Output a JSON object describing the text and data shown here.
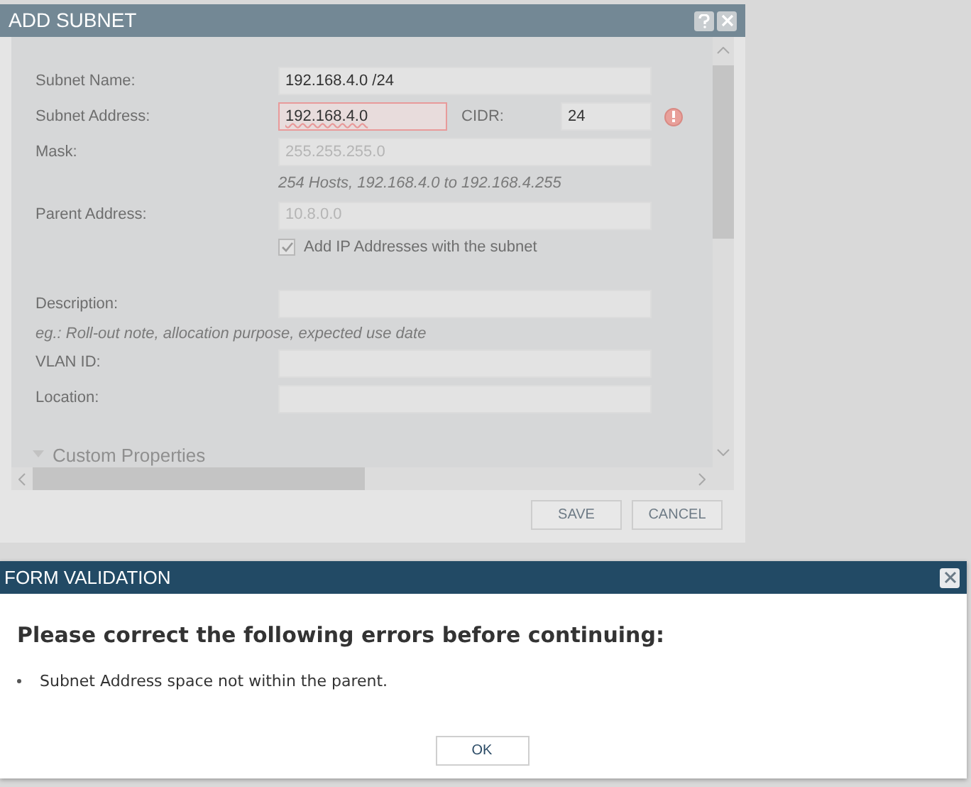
{
  "add_dialog": {
    "title": "ADD SUBNET",
    "subnet_name": {
      "label": "Subnet Name:",
      "value": "192.168.4.0 /24"
    },
    "subnet_address": {
      "label": "Subnet Address:",
      "value": "192.168.4.0",
      "error": true
    },
    "cidr": {
      "label": "CIDR:",
      "value": "24"
    },
    "mask": {
      "label": "Mask:",
      "value": "255.255.255.0",
      "disabled": true
    },
    "hosts_hint": "254 Hosts, 192.168.4.0 to 192.168.4.255",
    "parent_address": {
      "label": "Parent Address:",
      "value": "10.8.0.0",
      "disabled": true
    },
    "add_ip": {
      "label": "Add IP Addresses with the subnet",
      "checked": true
    },
    "description": {
      "label": "Description:"
    },
    "description_hint": "eg.: Roll-out note, allocation purpose, expected use date",
    "vlan_id": {
      "label": "VLAN ID:"
    },
    "location": {
      "label": "Location:"
    },
    "section": {
      "label": "Custom Properties",
      "expanded": true
    },
    "buttons": [
      "SAVE",
      "CANCEL"
    ]
  },
  "validation_dialog": {
    "title": "FORM VALIDATION",
    "heading": "Please correct the following errors before continuing:",
    "errors": [
      "Subnet Address space not within the parent."
    ],
    "button": "OK"
  }
}
